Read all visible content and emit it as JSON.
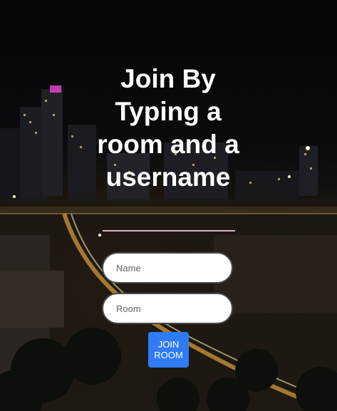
{
  "heading": "Join By Typing a room and a username",
  "form": {
    "name_placeholder": "Name",
    "room_placeholder": "Room",
    "join_label": "JOIN ROOM"
  },
  "colors": {
    "button": "#2f7bf5",
    "divider": "#d9b4c8",
    "text": "#ffffff"
  },
  "background": "night city skyline photo"
}
